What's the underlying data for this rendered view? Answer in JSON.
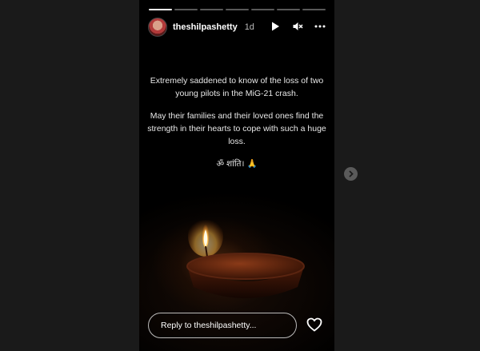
{
  "story": {
    "username": "theshilpashetty",
    "time_ago": "1d",
    "progress": {
      "segments": 7,
      "current": 1
    },
    "caption": {
      "paragraph1": "Extremely saddened to know of the loss of two young pilots in the MiG-21 crash.",
      "paragraph2": "May their families and their loved ones find the strength in their hearts to cope with such a huge loss.",
      "paragraph3": "ॐ शांति। 🙏"
    }
  },
  "controls": {
    "play_icon": "play-icon",
    "mute_icon": "muted-speaker-icon",
    "more_icon": "more-options-icon"
  },
  "reply": {
    "placeholder": "Reply to theshilpashetty...",
    "like_icon": "heart-icon"
  },
  "navigation": {
    "next_icon": "chevron-right-icon"
  },
  "colors": {
    "background": "#1a1a1a",
    "story_background": "#000000",
    "text": "#ffffff"
  }
}
